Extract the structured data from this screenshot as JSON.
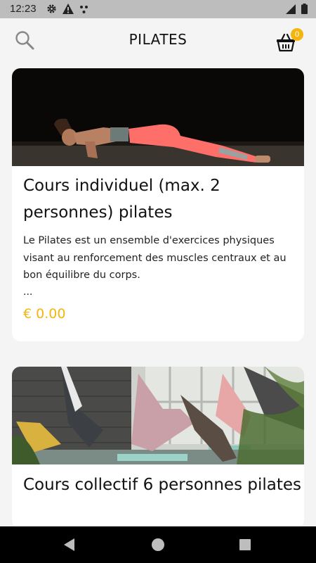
{
  "status_bar": {
    "time": "12:23",
    "icons_left": [
      "gear-icon",
      "warning-icon",
      "dots-icon"
    ],
    "icons_right": [
      "signal-icon",
      "battery-icon"
    ]
  },
  "app_bar": {
    "title": "PILATES",
    "search_icon": "search-icon",
    "cart_icon": "basket-icon",
    "cart_count": "0",
    "accent_color": "#f5b50f"
  },
  "products": [
    {
      "title": "Cours individuel (max. 2 personnes) pilates",
      "description": "Le Pilates est un ensemble d'exercices physiques visant au renforcement des muscles centraux et au bon équilibre du corps.",
      "ellipsis": "...",
      "price": "€ 0.00",
      "image": "woman-plank-photo"
    },
    {
      "title": "Cours collectif 6 personnes pilates",
      "image": "group-yoga-class-photo"
    }
  ],
  "nav_bar": {
    "back_icon": "back-triangle-icon",
    "home_icon": "home-circle-icon",
    "recent_icon": "recent-square-icon"
  }
}
